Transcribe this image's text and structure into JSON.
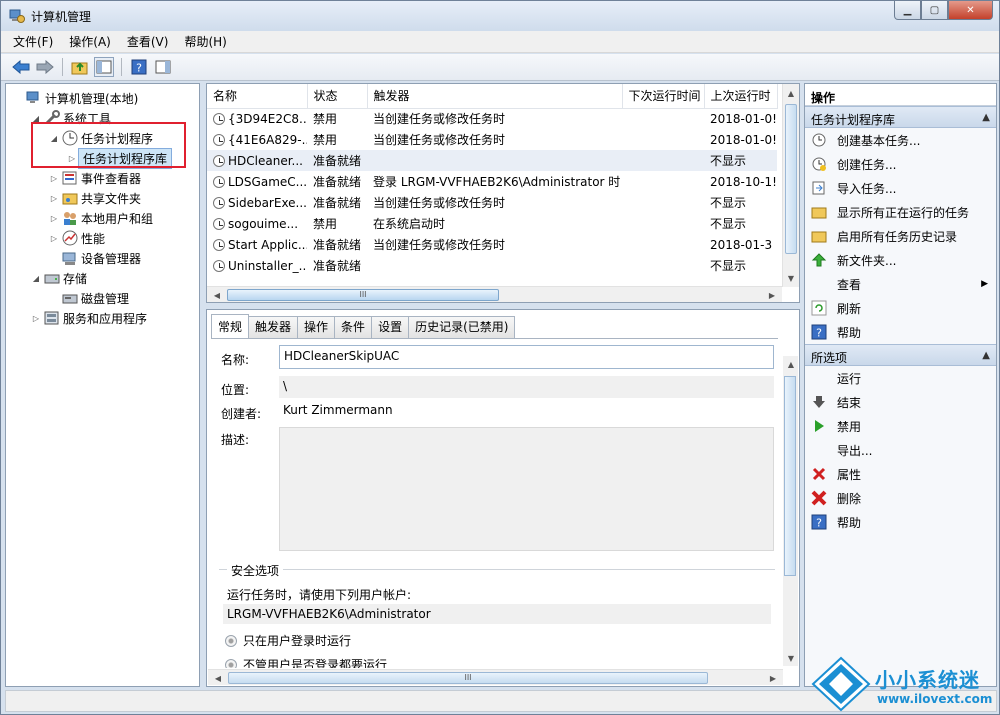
{
  "window": {
    "title": "计算机管理"
  },
  "menu": [
    "文件(F)",
    "操作(A)",
    "查看(V)",
    "帮助(H)"
  ],
  "tree": {
    "items": [
      {
        "label": "计算机管理(本地)",
        "arrow": "",
        "indent": 0,
        "icon": "computer-icon"
      },
      {
        "label": "系统工具",
        "arrow": "◢",
        "indent": 1,
        "icon": "tools-icon"
      },
      {
        "label": "任务计划程序",
        "arrow": "◢",
        "indent": 2,
        "icon": "clock-icon"
      },
      {
        "label": "任务计划程序库",
        "arrow": "▷",
        "indent": 3,
        "icon": "folder-icon",
        "selected": true
      },
      {
        "label": "事件查看器",
        "arrow": "▷",
        "indent": 2,
        "icon": "event-viewer-icon"
      },
      {
        "label": "共享文件夹",
        "arrow": "▷",
        "indent": 2,
        "icon": "shared-folder-icon"
      },
      {
        "label": "本地用户和组",
        "arrow": "▷",
        "indent": 2,
        "icon": "users-icon"
      },
      {
        "label": "性能",
        "arrow": "▷",
        "indent": 2,
        "icon": "performance-icon"
      },
      {
        "label": "设备管理器",
        "arrow": "",
        "indent": 2,
        "icon": "device-manager-icon"
      },
      {
        "label": "存储",
        "arrow": "◢",
        "indent": 1,
        "icon": "storage-icon"
      },
      {
        "label": "磁盘管理",
        "arrow": "",
        "indent": 2,
        "icon": "disk-icon"
      },
      {
        "label": "服务和应用程序",
        "arrow": "▷",
        "indent": 1,
        "icon": "services-icon"
      }
    ]
  },
  "tasklist": {
    "columns": [
      "名称",
      "状态",
      "触发器",
      "下次运行时间",
      "上次运行时"
    ],
    "rows": [
      [
        "{3D94E2C8...",
        "禁用",
        "当创建任务或修改任务时",
        "",
        "2018-01-0!"
      ],
      [
        "{41E6A829-...",
        "禁用",
        "当创建任务或修改任务时",
        "",
        "2018-01-0!"
      ],
      [
        "HDCleaner...",
        "准备就绪",
        "",
        "",
        "不显示"
      ],
      [
        "LDSGameC...",
        "准备就绪",
        "登录 LRGM-VVFHAEB2K6\\Administrator 时",
        "",
        "2018-10-1!"
      ],
      [
        "SidebarExe...",
        "准备就绪",
        "当创建任务或修改任务时",
        "",
        "不显示"
      ],
      [
        "sogouime...",
        "禁用",
        "在系统启动时",
        "",
        "不显示"
      ],
      [
        "Start Applic...",
        "准备就绪",
        "当创建任务或修改任务时",
        "",
        "2018-01-3"
      ],
      [
        "Uninstaller_...",
        "准备就绪",
        "",
        "",
        "不显示"
      ]
    ],
    "selected_row": 2,
    "hscroll_thumb": "III"
  },
  "detail": {
    "tabs": [
      "常规",
      "触发器",
      "操作",
      "条件",
      "设置",
      "历史记录(已禁用)"
    ],
    "name_label": "名称:",
    "name_value": "HDCleanerSkipUAC",
    "location_label": "位置:",
    "location_value": "\\",
    "author_label": "创建者:",
    "author_value": "Kurt Zimmermann",
    "desc_label": "描述:",
    "security_legend": "安全选项",
    "run_as_label": "运行任务时，请使用下列用户帐户:",
    "run_as_value": "LRGM-VVFHAEB2K6\\Administrator",
    "radio1": "只在用户登录时运行",
    "radio2": "不管用户是否登录都要运行",
    "hscroll_thumb": "III"
  },
  "actions": {
    "header": "操作",
    "section1": {
      "title": "任务计划程序库",
      "items": [
        {
          "label": "创建基本任务...",
          "icon": "create-basic-task-icon"
        },
        {
          "label": "创建任务...",
          "icon": "create-task-icon"
        },
        {
          "label": "导入任务...",
          "icon": "import-icon"
        },
        {
          "label": "显示所有正在运行的任务",
          "icon": "running-tasks-icon"
        },
        {
          "label": "启用所有任务历史记录",
          "icon": "history-icon"
        },
        {
          "label": "新文件夹...",
          "icon": "new-folder-icon"
        },
        {
          "label": "查看",
          "icon": "",
          "submenu": true
        },
        {
          "label": "刷新",
          "icon": "refresh-icon"
        },
        {
          "label": "帮助",
          "icon": "help-icon"
        }
      ]
    },
    "section2": {
      "title": "所选项",
      "items": [
        {
          "label": "运行",
          "icon": ""
        },
        {
          "label": "结束",
          "icon": "end-icon"
        },
        {
          "label": "禁用",
          "icon": "disable-icon"
        },
        {
          "label": "导出...",
          "icon": ""
        },
        {
          "label": "属性",
          "icon": "properties-icon"
        },
        {
          "label": "删除",
          "icon": "delete-icon"
        },
        {
          "label": "帮助",
          "icon": "help-icon"
        }
      ]
    }
  },
  "watermark": {
    "title": "小小系统迷",
    "url": "www.ilovext.com"
  },
  "colors": {
    "highlight_border": "#e0202f",
    "selection": "#cde5f7",
    "brand": "#1b8fd3"
  }
}
